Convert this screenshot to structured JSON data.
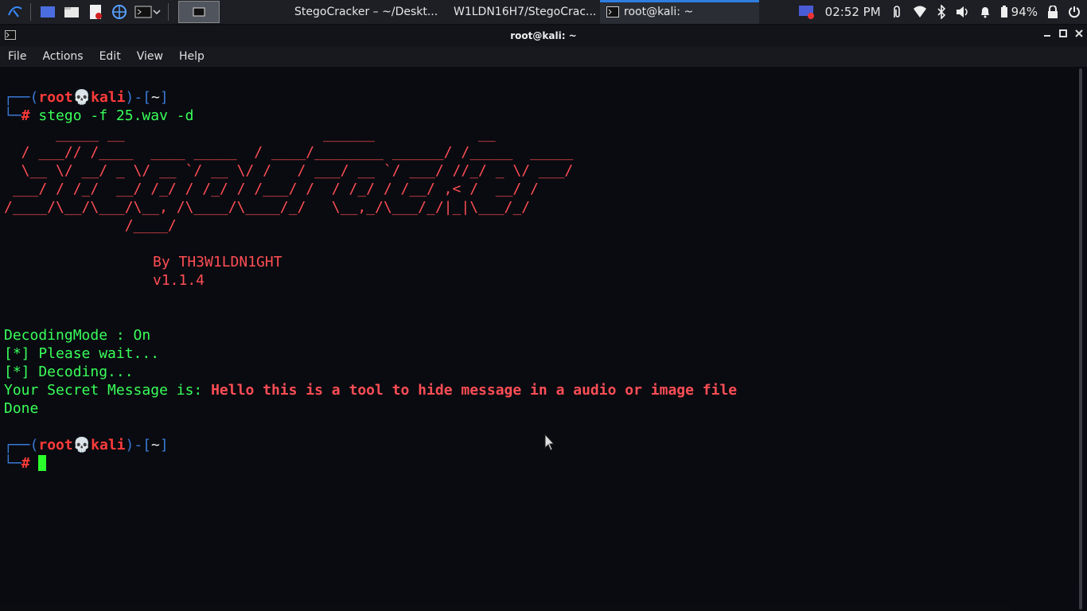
{
  "panel": {
    "tasks": [
      {
        "label": "StegoCracker – ~/Deskt..."
      },
      {
        "label": "W1LDN16H7/StegoCrac..."
      },
      {
        "label": "root@kali: ~"
      }
    ],
    "clock": "02:52 PM",
    "battery": "94%"
  },
  "window": {
    "title": "root@kali: ~",
    "menu": [
      "File",
      "Actions",
      "Edit",
      "View",
      "Help"
    ]
  },
  "terminal": {
    "prompt1_user": "root",
    "prompt1_host": "kali",
    "prompt1_dir": "~",
    "command": "stego -f 25.wav -d",
    "ascii_art": [
      "      _____ __                       ______            __",
      "  / ___// /____  ____ _____  / ____/________ ______/ /_____  _____",
      "  \\__ \\/ __/ _ \\/ __ `/ __ \\/ /   / ___/ __ `/ ___/ //_/ _ \\/ ___/",
      " ___/ / /_/  __/ /_/ / /_/ / /___/ /  / /_/ / /__/ ,< /  __/ /",
      "/____/\\__/\\___/\\__, /\\____/\\____/_/   \\__,_/\\___/_/|_|\\___/_/",
      "              /____/"
    ],
    "author": "By TH3W1LDN1GHT",
    "version": "v1.1.4",
    "mode_line": "DecodingMode : On",
    "wait_line": "[*] Please wait...",
    "decoding_line": "[*] Decoding...",
    "secret_label": "Your Secret Message is: ",
    "secret_message": "Hello this is a tool to hide message in a audio or image file",
    "done_line": "Done",
    "prompt2_user": "root",
    "prompt2_host": "kali",
    "prompt2_dir": "~"
  }
}
